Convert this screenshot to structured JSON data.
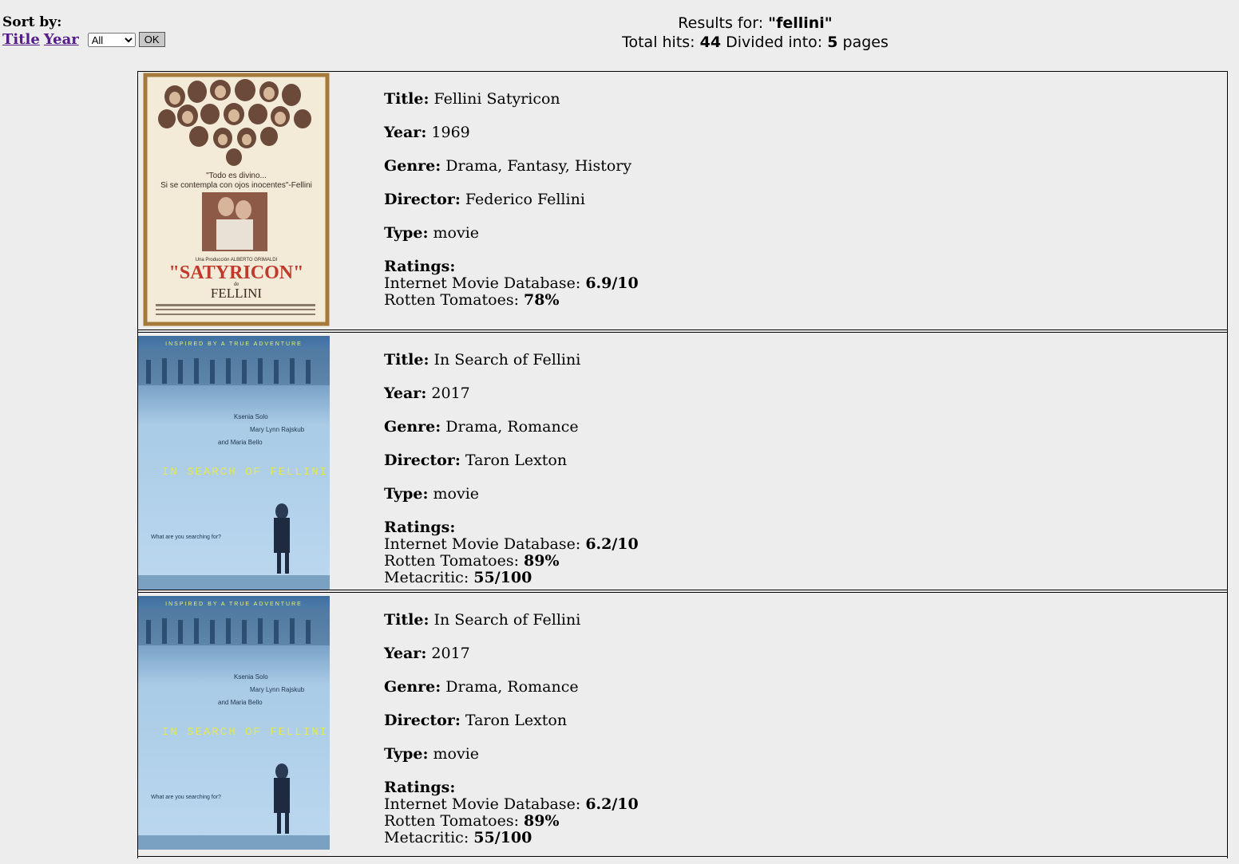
{
  "sort": {
    "label": "Sort by:",
    "title_link": "Title",
    "year_link": "Year",
    "filter_selected": "All",
    "ok_label": "OK"
  },
  "header": {
    "results_for_label": "Results for:",
    "query": "\"fellini\"",
    "total_hits_label": "Total hits:",
    "total_hits": "44",
    "divided_label": "Divided into:",
    "pages": "5",
    "pages_suffix": "pages"
  },
  "labels": {
    "title": "Title:",
    "year": "Year:",
    "genre": "Genre:",
    "director": "Director:",
    "type": "Type:",
    "ratings": "Ratings:"
  },
  "movies": [
    {
      "title": "Fellini Satyricon",
      "year": "1969",
      "genre": "Drama, Fantasy, History",
      "director": "Federico Fellini",
      "type": "movie",
      "poster": {
        "quote": "\"Todo es divino...",
        "quote2": "Si se contempla con ojos inocentes\"-Fellini",
        "producer": "Una Producción ALBERTO GRIMALDI",
        "name": "\"SATYRICON\"",
        "de": "de",
        "author": "FELLINI"
      },
      "ratings": [
        {
          "source": "Internet Movie Database:",
          "value": "6.9/10"
        },
        {
          "source": "Rotten Tomatoes:",
          "value": "78%"
        }
      ]
    },
    {
      "title": "In Search of Fellini",
      "year": "2017",
      "genre": "Drama, Romance",
      "director": "Taron Lexton",
      "type": "movie",
      "poster": {
        "tagline": "INSPIRED BY A TRUE ADVENTURE",
        "cast1": "Ksenia Solo",
        "cast2": "Mary Lynn Rajskub",
        "cast3": "and Maria Bello",
        "name": "IN SEARCH OF FELLINI",
        "question": "What are you searching for?"
      },
      "ratings": [
        {
          "source": "Internet Movie Database:",
          "value": "6.2/10"
        },
        {
          "source": "Rotten Tomatoes:",
          "value": "89%"
        },
        {
          "source": "Metacritic:",
          "value": "55/100"
        }
      ]
    },
    {
      "title": "In Search of Fellini",
      "year": "2017",
      "genre": "Drama, Romance",
      "director": "Taron Lexton",
      "type": "movie",
      "poster": {
        "tagline": "INSPIRED BY A TRUE ADVENTURE",
        "cast1": "Ksenia Solo",
        "cast2": "Mary Lynn Rajskub",
        "cast3": "and Maria Bello",
        "name": "IN SEARCH OF FELLINI",
        "question": "What are you searching for?"
      },
      "ratings": [
        {
          "source": "Internet Movie Database:",
          "value": "6.2/10"
        },
        {
          "source": "Rotten Tomatoes:",
          "value": "89%"
        },
        {
          "source": "Metacritic:",
          "value": "55/100"
        }
      ]
    }
  ]
}
